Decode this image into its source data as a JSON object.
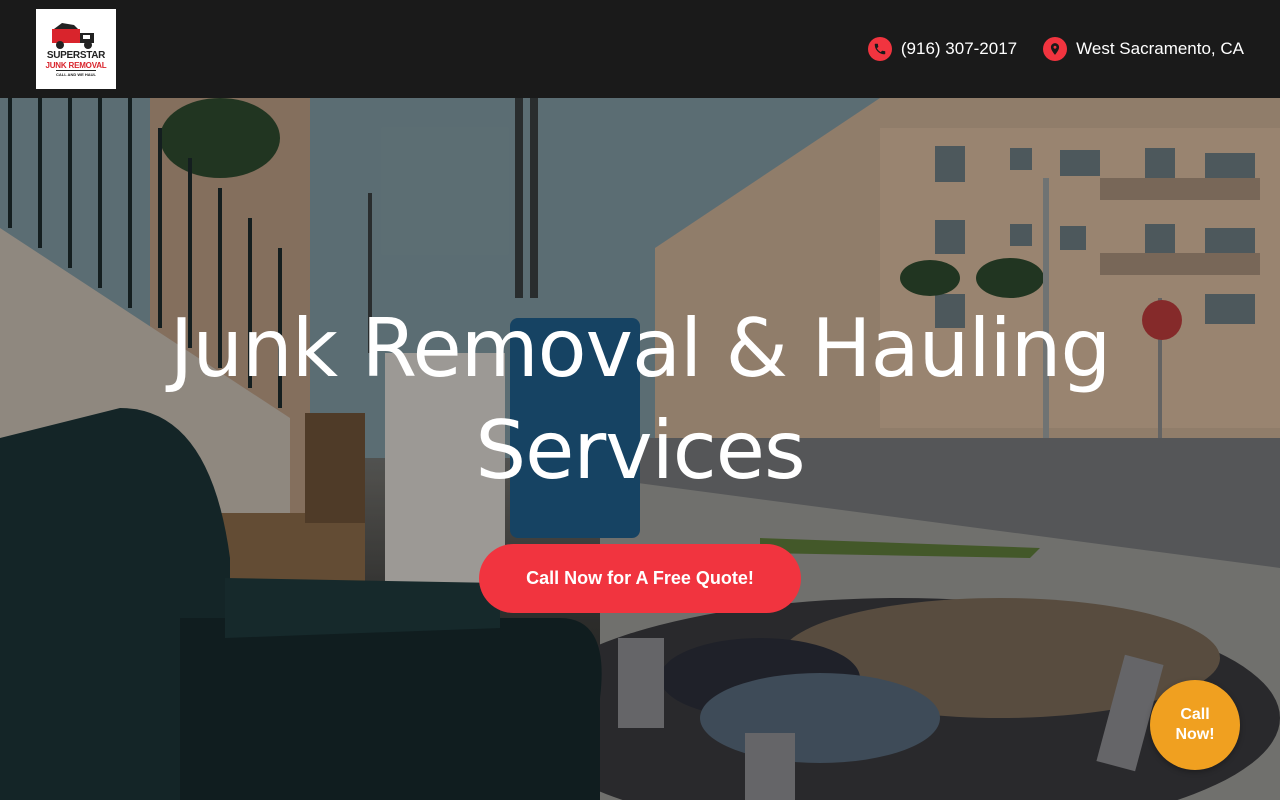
{
  "logo": {
    "line1": "SUPERSTAR",
    "line2": "JUNK REMOVAL",
    "line3": "CALL AND WE HAUL"
  },
  "header": {
    "phone": "(916) 307-2017",
    "location": "West Sacramento, CA",
    "phone_icon": "phone-icon",
    "location_icon": "map-pin-icon",
    "accent_color": "#f1343f"
  },
  "hero": {
    "title": "Junk Removal & Hauling Services",
    "cta_label": "Call Now for A Free Quote!"
  },
  "floating": {
    "call_label_line1": "Call",
    "call_label_line2": "Now!",
    "color": "#f0a020"
  }
}
